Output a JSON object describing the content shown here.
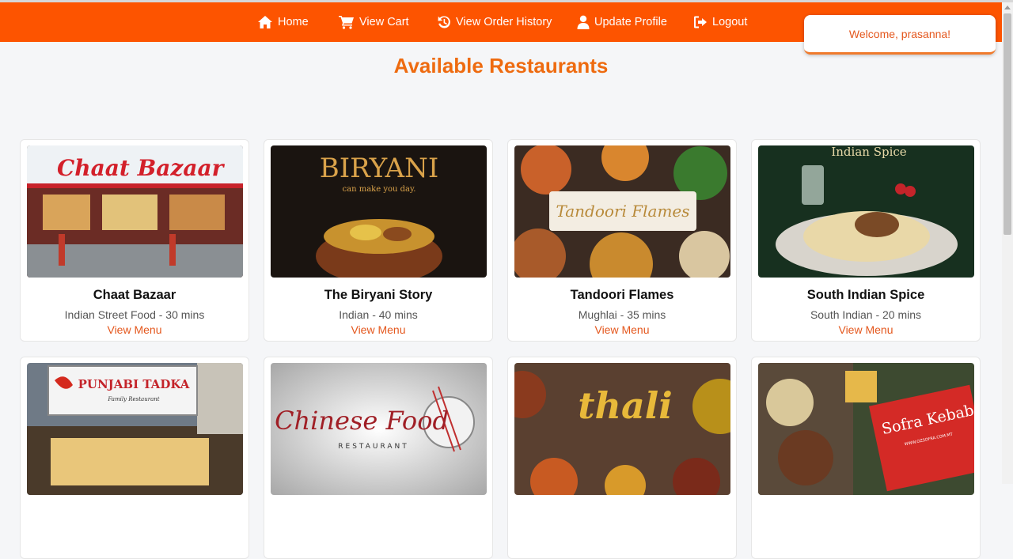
{
  "nav": {
    "items": [
      {
        "label": "Home",
        "icon": "home-icon"
      },
      {
        "label": "View Cart",
        "icon": "cart-icon"
      },
      {
        "label": "View Order History",
        "icon": "history-icon"
      },
      {
        "label": "Update Profile",
        "icon": "user-icon"
      },
      {
        "label": "Logout",
        "icon": "logout-icon"
      }
    ]
  },
  "toast": {
    "message": "Welcome, prasanna!"
  },
  "page": {
    "title": "Available Restaurants"
  },
  "restaurants": [
    {
      "name": "Chaat Bazaar",
      "meta": "Indian Street Food - 30 mins",
      "link": "View Menu",
      "image_text": "Chaat Bazaar"
    },
    {
      "name": "The Biryani Story",
      "meta": "Indian - 40 mins",
      "link": "View Menu",
      "image_text": "BIRYANI",
      "image_subtext": "can make you day."
    },
    {
      "name": "Tandoori Flames",
      "meta": "Mughlai - 35 mins",
      "link": "View Menu",
      "image_text": "Tandoori Flames"
    },
    {
      "name": "South Indian Spice",
      "meta": "South Indian - 20 mins",
      "link": "View Menu",
      "image_text": "Indian Spice"
    },
    {
      "image_text": "PUNJABI TADKA",
      "image_subtext": "Family Restaurant"
    },
    {
      "image_text": "Chinese Food",
      "image_subtext": "RESTAURANT"
    },
    {
      "image_text": "thali"
    },
    {
      "image_text": "Sofra Kebab",
      "image_subtext": "WWW.OZSOFRA.COM.MT"
    }
  ],
  "colors": {
    "brand": "#fd5400",
    "title": "#ee6b10",
    "link": "#e4571d"
  }
}
